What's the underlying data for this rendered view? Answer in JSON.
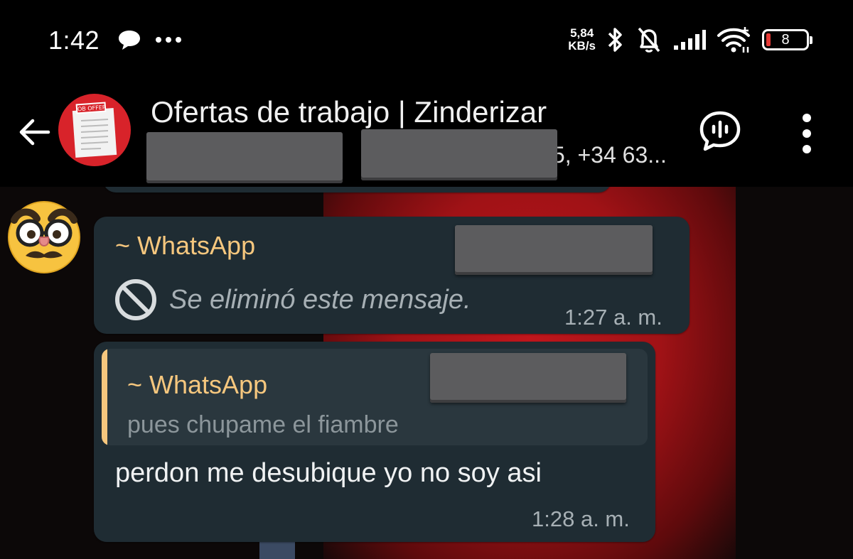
{
  "status_bar": {
    "time": "1:42",
    "net_speed_value": "5,84",
    "net_speed_unit": "KB/s",
    "battery_level": "8"
  },
  "header": {
    "title": "Ofertas de trabajo | Zinderizar",
    "avatar_label": "JOB OFFER",
    "members_sep1": ",",
    "members_tail": "5, +34 63..."
  },
  "messages": [
    {
      "sender": "~ WhatsApp",
      "text": "Se eliminó este mensaje.",
      "time": "1:27 a. m.",
      "deleted": true
    },
    {
      "sender": "~ WhatsApp",
      "quoted_text": "pues chupame el fiambre",
      "text": "perdon me desubique yo no soy asi",
      "time": "1:28 a. m."
    }
  ],
  "colors": {
    "bubble": "#1f2c33",
    "sender": "#f6c77e",
    "wallpaper_red": "#b0151a"
  }
}
